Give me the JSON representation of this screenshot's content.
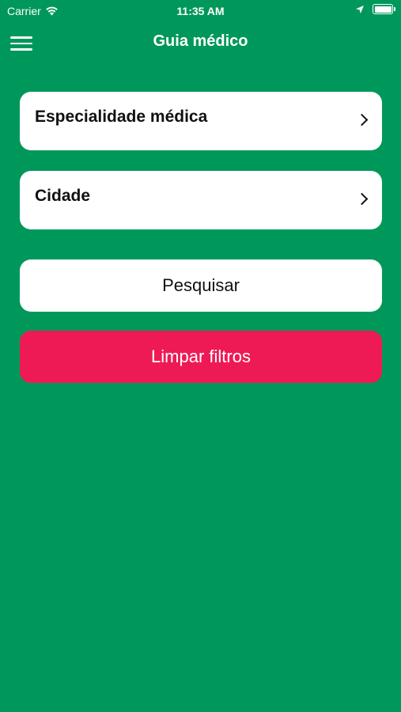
{
  "status_bar": {
    "carrier": "Carrier",
    "time": "11:35 AM"
  },
  "nav": {
    "title": "Guia médico",
    "menu_icon": "hamburger-menu-icon"
  },
  "filters": [
    {
      "label": "Especialidade médica",
      "icon": "chevron-right-icon"
    },
    {
      "label": "Cidade",
      "icon": "chevron-right-icon"
    }
  ],
  "actions": {
    "search_label": "Pesquisar",
    "clear_label": "Limpar filtros"
  },
  "colors": {
    "background": "#00985a",
    "clear_button": "#ee1a55",
    "card": "#ffffff"
  }
}
